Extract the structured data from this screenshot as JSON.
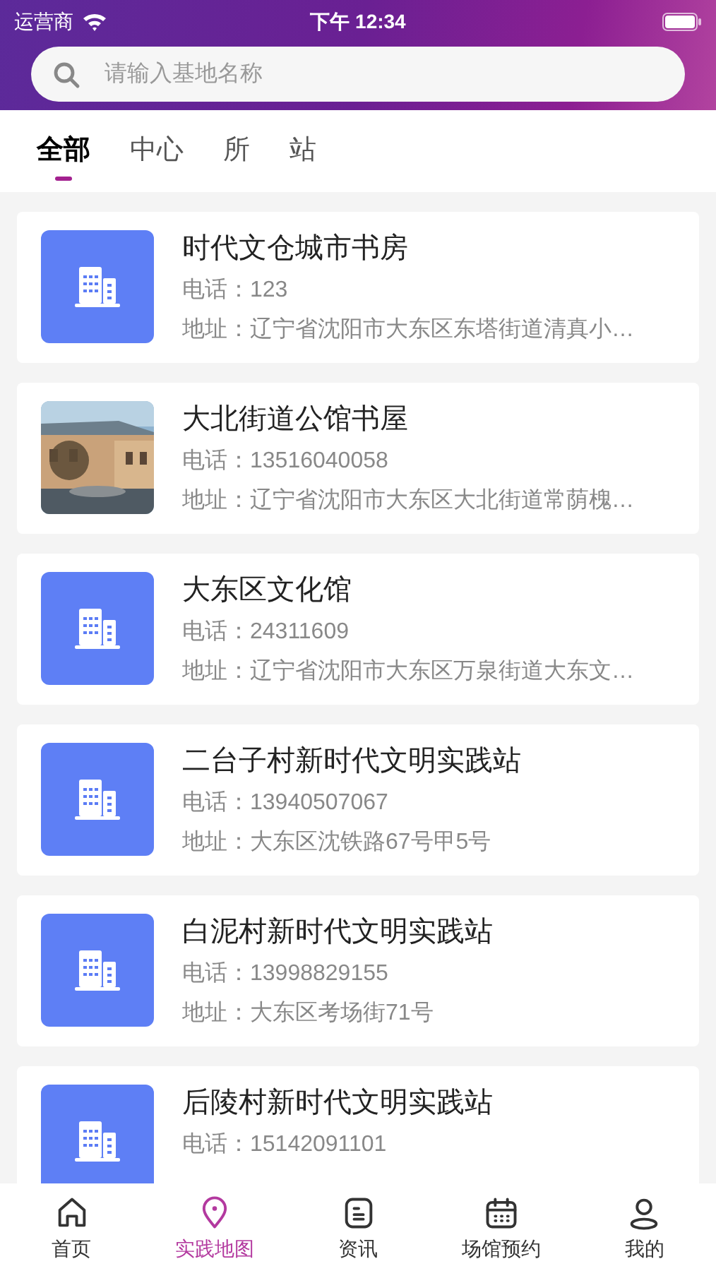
{
  "status_bar": {
    "carrier": "运营商",
    "time": "下午 12:34"
  },
  "search": {
    "placeholder": "请输入基地名称"
  },
  "tabs": [
    {
      "label": "全部",
      "selected": true
    },
    {
      "label": "中心",
      "selected": false
    },
    {
      "label": "所",
      "selected": false
    },
    {
      "label": "站",
      "selected": false
    }
  ],
  "venues": [
    {
      "kind": "icon",
      "name": "时代文仓城市书房",
      "phone": "电话：123",
      "address": "地址：辽宁省沈阳市大东区东塔街道清真小…"
    },
    {
      "kind": "picture",
      "name": "大北街道公馆书屋",
      "phone": "电话：13516040058",
      "address": "地址：辽宁省沈阳市大东区大北街道常荫槐…"
    },
    {
      "kind": "icon",
      "name": "大东区文化馆",
      "phone": "电话：24311609",
      "address": "地址：辽宁省沈阳市大东区万泉街道大东文…"
    },
    {
      "kind": "icon",
      "name": "二台子村新时代文明实践站",
      "phone": "电话：13940507067",
      "address": "地址：大东区沈铁路67号甲5号"
    },
    {
      "kind": "icon",
      "name": "白泥村新时代文明实践站",
      "phone": "电话：13998829155",
      "address": "地址：大东区考场街71号"
    },
    {
      "kind": "icon",
      "name": "后陵村新时代文明实践站",
      "phone": "电话：15142091101"
    }
  ],
  "tab_bar": [
    {
      "kind": "home",
      "label": "首页",
      "selected": false
    },
    {
      "kind": "map",
      "label": "实践地图",
      "selected": true
    },
    {
      "kind": "news",
      "label": "资讯",
      "selected": false
    },
    {
      "kind": "calendar",
      "label": "场馆预约",
      "selected": false
    },
    {
      "kind": "user",
      "label": "我的",
      "selected": false
    }
  ]
}
